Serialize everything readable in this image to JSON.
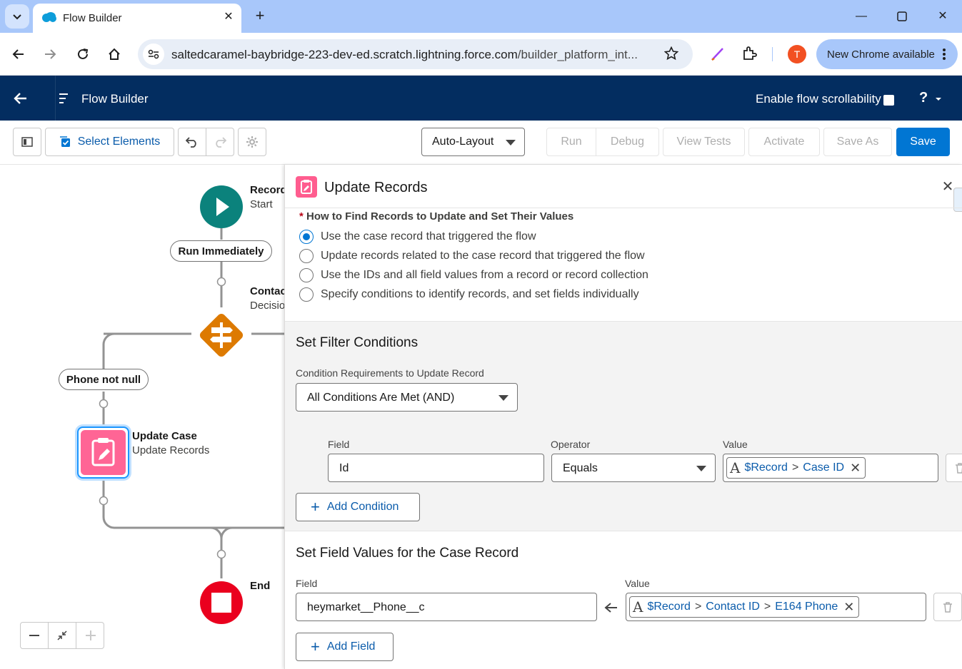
{
  "browser": {
    "tab_title": "Flow Builder",
    "url_host": "saltedcaramel-baybridge-223-dev-ed.scratch.lightning.force.com",
    "url_path": "/builder_platform_int...",
    "avatar_letter": "T",
    "update_label": "New Chrome available"
  },
  "header": {
    "title": "Flow Builder",
    "scroll_label": "Enable flow scrollability",
    "help": "?"
  },
  "toolbar": {
    "select_elements": "Select Elements",
    "layout_value": "Auto-Layout",
    "run": "Run",
    "debug": "Debug",
    "view_tests": "View Tests",
    "activate": "Activate",
    "save_as": "Save As",
    "save": "Save"
  },
  "canvas": {
    "start_title": "Record",
    "start_sub": "Start",
    "run_immediately": "Run Immediately",
    "decision_title": "Contac",
    "decision_sub": "Decisio",
    "branch_label": "Phone not null",
    "update_title": "Update Case",
    "update_sub": "Update Records",
    "end_label": "End"
  },
  "panel": {
    "title": "Update Records",
    "how_label": "How to Find Records to Update and Set Their Values",
    "required_mark": "*",
    "options": [
      "Use the case record that triggered the flow",
      "Update records related to the case record that triggered the flow",
      "Use the IDs and all field values from a record or record collection",
      "Specify conditions to identify records, and set fields individually"
    ],
    "filter_title": "Set Filter Conditions",
    "cond_req_label": "Condition Requirements to Update Record",
    "cond_req_value": "All Conditions Are Met (AND)",
    "field_label": "Field",
    "operator_label": "Operator",
    "value_label": "Value",
    "cond_field": "Id",
    "cond_operator": "Equals",
    "cond_value_parts": [
      "$Record",
      ">",
      "Case ID"
    ],
    "add_condition": "Add Condition",
    "set_fields_title": "Set Field Values for the Case Record",
    "set_field_label": "Field",
    "set_value_label": "Value",
    "set_field_value": "heymarket__Phone__c",
    "set_value_parts": [
      "$Record",
      ">",
      "Contact ID",
      ">",
      "E164 Phone"
    ],
    "add_field": "Add Field",
    "aa_icon": "A"
  }
}
